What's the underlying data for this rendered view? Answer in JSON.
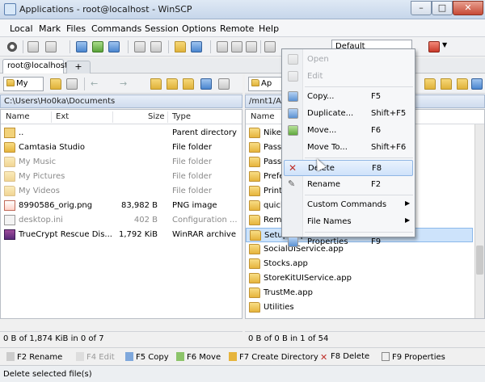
{
  "window": {
    "title": "Applications - root@localhost - WinSCP"
  },
  "menu": [
    "Local",
    "Mark",
    "Files",
    "Commands",
    "Session",
    "Options",
    "Remote",
    "Help"
  ],
  "toolbar": {
    "transfer_setting": "Default"
  },
  "tabs": {
    "session": "root@localhost",
    "new_tab": "+"
  },
  "left_panel": {
    "drive": "My",
    "path": "C:\\Users\\Ho0ka\\Documents",
    "columns": [
      "Name",
      "Ext",
      "Size",
      "Type"
    ],
    "rows": [
      {
        "name": "..",
        "ext": "",
        "size": "",
        "type": "Parent directory",
        "icon": "up",
        "dim": false
      },
      {
        "name": "Camtasia Studio",
        "ext": "",
        "size": "",
        "type": "File folder",
        "icon": "folder",
        "dim": false
      },
      {
        "name": "My Music",
        "ext": "",
        "size": "",
        "type": "File folder",
        "icon": "folder",
        "dim": true
      },
      {
        "name": "My Pictures",
        "ext": "",
        "size": "",
        "type": "File folder",
        "icon": "folder",
        "dim": true
      },
      {
        "name": "My Videos",
        "ext": "",
        "size": "",
        "type": "File folder",
        "icon": "folder",
        "dim": true
      },
      {
        "name": "8990586_orig.png",
        "ext": "",
        "size": "83,982 B",
        "type": "PNG image",
        "icon": "png",
        "dim": false
      },
      {
        "name": "desktop.ini",
        "ext": "",
        "size": "402 B",
        "type": "Configuration ...",
        "icon": "ini",
        "dim": true
      },
      {
        "name": "TrueCrypt Rescue Dis...",
        "ext": "",
        "size": "1,792 KiB",
        "type": "WinRAR archive",
        "icon": "rar",
        "dim": false
      }
    ],
    "status": "0 B of 1,874 KiB in 0 of 7"
  },
  "right_panel": {
    "drive": "Ap",
    "path": "/mnt1/Ap",
    "columns": [
      "Name"
    ],
    "rows": [
      "Nike.",
      "Passl",
      "Passl",
      "Prefe",
      "Print",
      "quick",
      "Remo",
      "Setup.app",
      "SocialUIService.app",
      "Stocks.app",
      "StoreKitUIService.app",
      "TrustMe.app",
      "Utilities"
    ],
    "selected_index": 7,
    "status": "0 B of 0 B in 1 of 54"
  },
  "context_menu": {
    "items": [
      {
        "label": "Open",
        "key": "",
        "disabled": true,
        "icon": "gray"
      },
      {
        "label": "Edit",
        "key": "",
        "disabled": true,
        "icon": "gray"
      },
      {
        "label": "Copy...",
        "key": "F5",
        "disabled": false,
        "icon": "blue"
      },
      {
        "label": "Duplicate...",
        "key": "Shift+F5",
        "disabled": false,
        "icon": "blue"
      },
      {
        "label": "Move...",
        "key": "F6",
        "disabled": false,
        "icon": "green"
      },
      {
        "label": "Move To...",
        "key": "Shift+F6",
        "disabled": false,
        "icon": ""
      },
      {
        "label": "Delete",
        "key": "F8",
        "disabled": false,
        "icon": "delete",
        "highlighted": true
      },
      {
        "label": "Rename",
        "key": "F2",
        "disabled": false,
        "icon": "pencil"
      },
      {
        "label": "Custom Commands",
        "key": "",
        "disabled": false,
        "submenu": true,
        "icon": ""
      },
      {
        "label": "File Names",
        "key": "",
        "disabled": false,
        "submenu": true,
        "icon": ""
      },
      {
        "label": "Properties",
        "key": "F9",
        "disabled": false,
        "icon": "blue"
      }
    ]
  },
  "function_keys": [
    {
      "label": "F2 Rename",
      "disabled": false
    },
    {
      "label": "F4 Edit",
      "disabled": true
    },
    {
      "label": "F5 Copy",
      "disabled": false
    },
    {
      "label": "F6 Move",
      "disabled": false
    },
    {
      "label": "F7 Create Directory",
      "disabled": false
    },
    {
      "label": "F8 Delete",
      "disabled": false
    },
    {
      "label": "F9 Properties",
      "disabled": false
    }
  ],
  "statusbar": "Delete selected file(s)"
}
